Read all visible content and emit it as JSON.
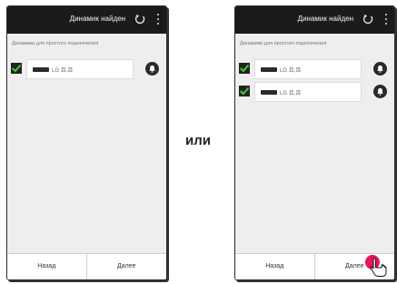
{
  "left_screen": {
    "title": "Динамик найден",
    "section_label": "Динамики для простого подключения",
    "speakers": [
      {
        "name": "LG 且,且"
      }
    ],
    "back_label": "Назад",
    "next_label": "Далее"
  },
  "right_screen": {
    "title": "Динамик найден",
    "section_label": "Динамики для простого подключения",
    "speakers": [
      {
        "name": "LG 且,且"
      },
      {
        "name": "LG 且,且"
      }
    ],
    "back_label": "Назад",
    "next_label": "Далее"
  },
  "separator_label": "или",
  "colors": {
    "topbar": "#1b1b1b",
    "check_mark": "#3ccc2e",
    "tap_indicator": "#e8145a"
  },
  "icons": [
    "refresh-icon",
    "more-vert-icon",
    "check-icon",
    "bell-icon",
    "pointing-hand-icon"
  ]
}
